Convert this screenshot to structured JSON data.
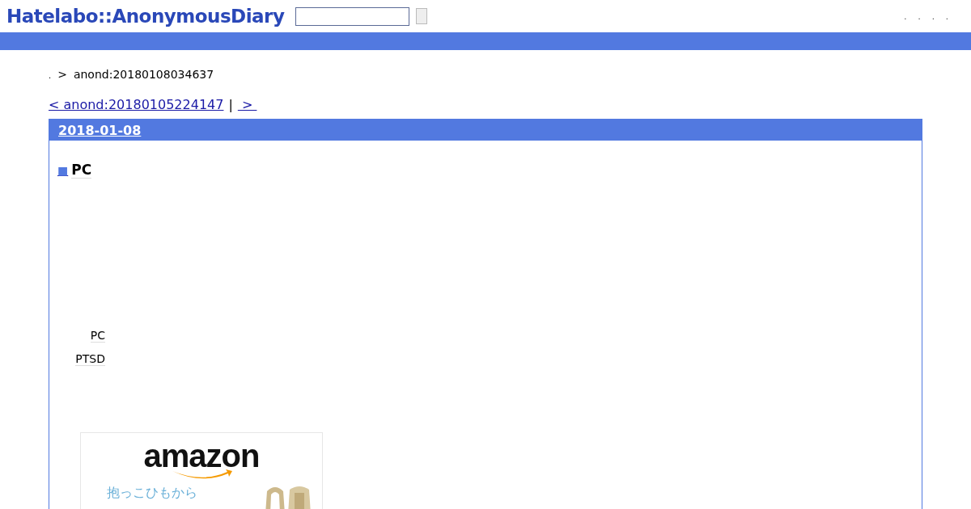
{
  "header": {
    "logo": "Hatelabo::AnonymousDiary",
    "links": [
      ".",
      ".",
      ".",
      "."
    ]
  },
  "breadcrumb": {
    "home": ".",
    "separator": ">",
    "current": "anond:20180108034637"
  },
  "pager": {
    "prev": "< anond:20180105224147",
    "separator": "|",
    "next": " > "
  },
  "day": {
    "date": "2018-01-08",
    "section": {
      "marker": "■",
      "title": "PC"
    },
    "keywords": [
      "PC",
      "PTSD"
    ]
  },
  "ad": {
    "logo": "amazon",
    "caption": "抱っこひもから"
  }
}
